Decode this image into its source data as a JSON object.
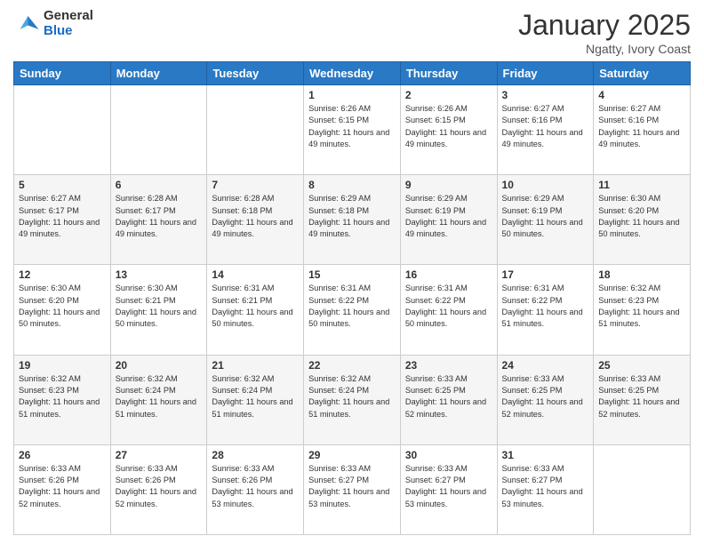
{
  "header": {
    "logo_general": "General",
    "logo_blue": "Blue",
    "month_title": "January 2025",
    "subtitle": "Ngatty, Ivory Coast"
  },
  "days_of_week": [
    "Sunday",
    "Monday",
    "Tuesday",
    "Wednesday",
    "Thursday",
    "Friday",
    "Saturday"
  ],
  "weeks": [
    [
      {
        "day": "",
        "info": ""
      },
      {
        "day": "",
        "info": ""
      },
      {
        "day": "",
        "info": ""
      },
      {
        "day": "1",
        "info": "Sunrise: 6:26 AM\nSunset: 6:15 PM\nDaylight: 11 hours\nand 49 minutes."
      },
      {
        "day": "2",
        "info": "Sunrise: 6:26 AM\nSunset: 6:15 PM\nDaylight: 11 hours\nand 49 minutes."
      },
      {
        "day": "3",
        "info": "Sunrise: 6:27 AM\nSunset: 6:16 PM\nDaylight: 11 hours\nand 49 minutes."
      },
      {
        "day": "4",
        "info": "Sunrise: 6:27 AM\nSunset: 6:16 PM\nDaylight: 11 hours\nand 49 minutes."
      }
    ],
    [
      {
        "day": "5",
        "info": "Sunrise: 6:27 AM\nSunset: 6:17 PM\nDaylight: 11 hours\nand 49 minutes."
      },
      {
        "day": "6",
        "info": "Sunrise: 6:28 AM\nSunset: 6:17 PM\nDaylight: 11 hours\nand 49 minutes."
      },
      {
        "day": "7",
        "info": "Sunrise: 6:28 AM\nSunset: 6:18 PM\nDaylight: 11 hours\nand 49 minutes."
      },
      {
        "day": "8",
        "info": "Sunrise: 6:29 AM\nSunset: 6:18 PM\nDaylight: 11 hours\nand 49 minutes."
      },
      {
        "day": "9",
        "info": "Sunrise: 6:29 AM\nSunset: 6:19 PM\nDaylight: 11 hours\nand 49 minutes."
      },
      {
        "day": "10",
        "info": "Sunrise: 6:29 AM\nSunset: 6:19 PM\nDaylight: 11 hours\nand 50 minutes."
      },
      {
        "day": "11",
        "info": "Sunrise: 6:30 AM\nSunset: 6:20 PM\nDaylight: 11 hours\nand 50 minutes."
      }
    ],
    [
      {
        "day": "12",
        "info": "Sunrise: 6:30 AM\nSunset: 6:20 PM\nDaylight: 11 hours\nand 50 minutes."
      },
      {
        "day": "13",
        "info": "Sunrise: 6:30 AM\nSunset: 6:21 PM\nDaylight: 11 hours\nand 50 minutes."
      },
      {
        "day": "14",
        "info": "Sunrise: 6:31 AM\nSunset: 6:21 PM\nDaylight: 11 hours\nand 50 minutes."
      },
      {
        "day": "15",
        "info": "Sunrise: 6:31 AM\nSunset: 6:22 PM\nDaylight: 11 hours\nand 50 minutes."
      },
      {
        "day": "16",
        "info": "Sunrise: 6:31 AM\nSunset: 6:22 PM\nDaylight: 11 hours\nand 50 minutes."
      },
      {
        "day": "17",
        "info": "Sunrise: 6:31 AM\nSunset: 6:22 PM\nDaylight: 11 hours\nand 51 minutes."
      },
      {
        "day": "18",
        "info": "Sunrise: 6:32 AM\nSunset: 6:23 PM\nDaylight: 11 hours\nand 51 minutes."
      }
    ],
    [
      {
        "day": "19",
        "info": "Sunrise: 6:32 AM\nSunset: 6:23 PM\nDaylight: 11 hours\nand 51 minutes."
      },
      {
        "day": "20",
        "info": "Sunrise: 6:32 AM\nSunset: 6:24 PM\nDaylight: 11 hours\nand 51 minutes."
      },
      {
        "day": "21",
        "info": "Sunrise: 6:32 AM\nSunset: 6:24 PM\nDaylight: 11 hours\nand 51 minutes."
      },
      {
        "day": "22",
        "info": "Sunrise: 6:32 AM\nSunset: 6:24 PM\nDaylight: 11 hours\nand 51 minutes."
      },
      {
        "day": "23",
        "info": "Sunrise: 6:33 AM\nSunset: 6:25 PM\nDaylight: 11 hours\nand 52 minutes."
      },
      {
        "day": "24",
        "info": "Sunrise: 6:33 AM\nSunset: 6:25 PM\nDaylight: 11 hours\nand 52 minutes."
      },
      {
        "day": "25",
        "info": "Sunrise: 6:33 AM\nSunset: 6:25 PM\nDaylight: 11 hours\nand 52 minutes."
      }
    ],
    [
      {
        "day": "26",
        "info": "Sunrise: 6:33 AM\nSunset: 6:26 PM\nDaylight: 11 hours\nand 52 minutes."
      },
      {
        "day": "27",
        "info": "Sunrise: 6:33 AM\nSunset: 6:26 PM\nDaylight: 11 hours\nand 52 minutes."
      },
      {
        "day": "28",
        "info": "Sunrise: 6:33 AM\nSunset: 6:26 PM\nDaylight: 11 hours\nand 53 minutes."
      },
      {
        "day": "29",
        "info": "Sunrise: 6:33 AM\nSunset: 6:27 PM\nDaylight: 11 hours\nand 53 minutes."
      },
      {
        "day": "30",
        "info": "Sunrise: 6:33 AM\nSunset: 6:27 PM\nDaylight: 11 hours\nand 53 minutes."
      },
      {
        "day": "31",
        "info": "Sunrise: 6:33 AM\nSunset: 6:27 PM\nDaylight: 11 hours\nand 53 minutes."
      },
      {
        "day": "",
        "info": ""
      }
    ]
  ]
}
